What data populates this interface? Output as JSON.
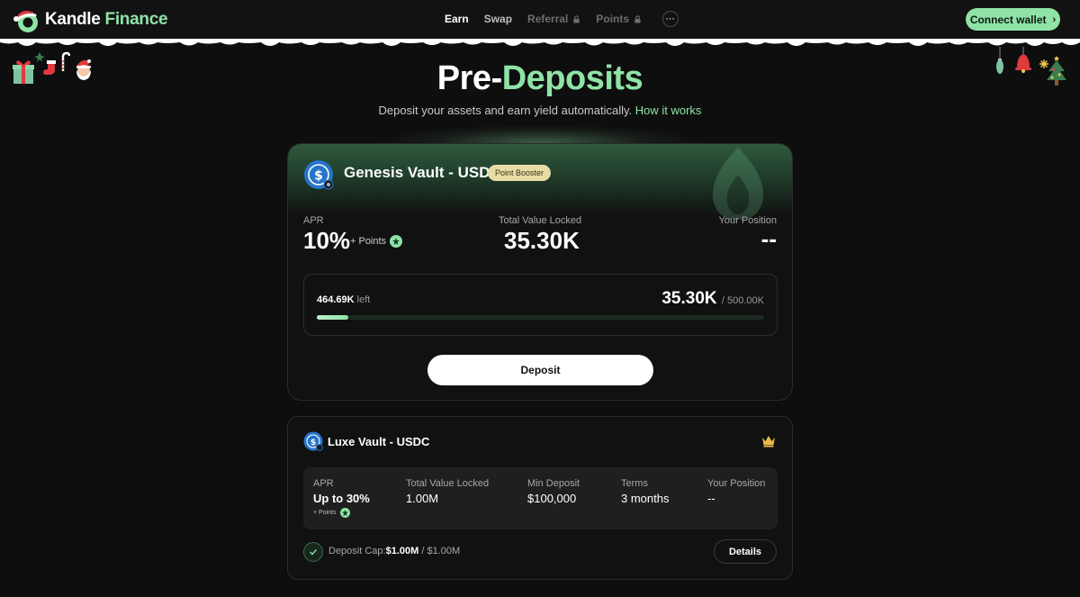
{
  "brand": {
    "name_part1": "Kandle",
    "name_part2": " Finance"
  },
  "nav": {
    "items": [
      {
        "label": "Earn",
        "state": "active"
      },
      {
        "label": "Swap",
        "state": "normal"
      },
      {
        "label": "Referral",
        "state": "locked"
      },
      {
        "label": "Points",
        "state": "locked"
      }
    ],
    "more": "···"
  },
  "header": {
    "connect_label": "Connect wallet"
  },
  "hero": {
    "title_part1": "Pre-",
    "title_part2": "Deposits",
    "subtitle": "Deposit your assets and earn yield automatically.",
    "link": "How it works"
  },
  "vault1": {
    "title": "Genesis Vault - USDC",
    "badge": "Point Booster",
    "apr_label": "APR",
    "apr_value": "10%",
    "points_label": "+ Points",
    "tvl_label": "Total Value Locked",
    "tvl_value": "35.30K",
    "position_label": "Your Position",
    "position_value": "--",
    "left_amount": "464.69K",
    "left_suffix": "left",
    "cap_current": "35.30K",
    "cap_total": "/ 500.00K",
    "progress_fraction": 0.0706,
    "deposit_label": "Deposit"
  },
  "vault2": {
    "title": "Luxe Vault - USDC",
    "apr_label": "APR",
    "apr_value": "Up to 30%",
    "points_label": "+ Points",
    "tvl_label": "Total Value Locked",
    "tvl_value": "1.00M",
    "min_label": "Min Deposit",
    "min_value": "$100,000",
    "terms_label": "Terms",
    "terms_value": "3 months",
    "position_label": "Your Position",
    "position_value": "--",
    "cap_label": "Deposit Cap:",
    "cap_current": "$1.00M",
    "cap_total": " / $1.00M",
    "details_label": "Details"
  },
  "colors": {
    "accent": "#8fe3a6",
    "background": "#0e0e0e",
    "card": "#111111",
    "badge": "#e7dca6"
  },
  "icons": [
    "santa-hat-logo-icon",
    "lock-icon",
    "chevron-right-icon",
    "usdc-icon",
    "star-icon",
    "crown-icon",
    "check-icon",
    "gift-icon",
    "stocking-icon",
    "candy-cane-icon",
    "santa-icon",
    "ornament-icon",
    "bell-icon",
    "christmas-tree-icon",
    "snowflake-icon",
    "flame-watermark-icon"
  ]
}
